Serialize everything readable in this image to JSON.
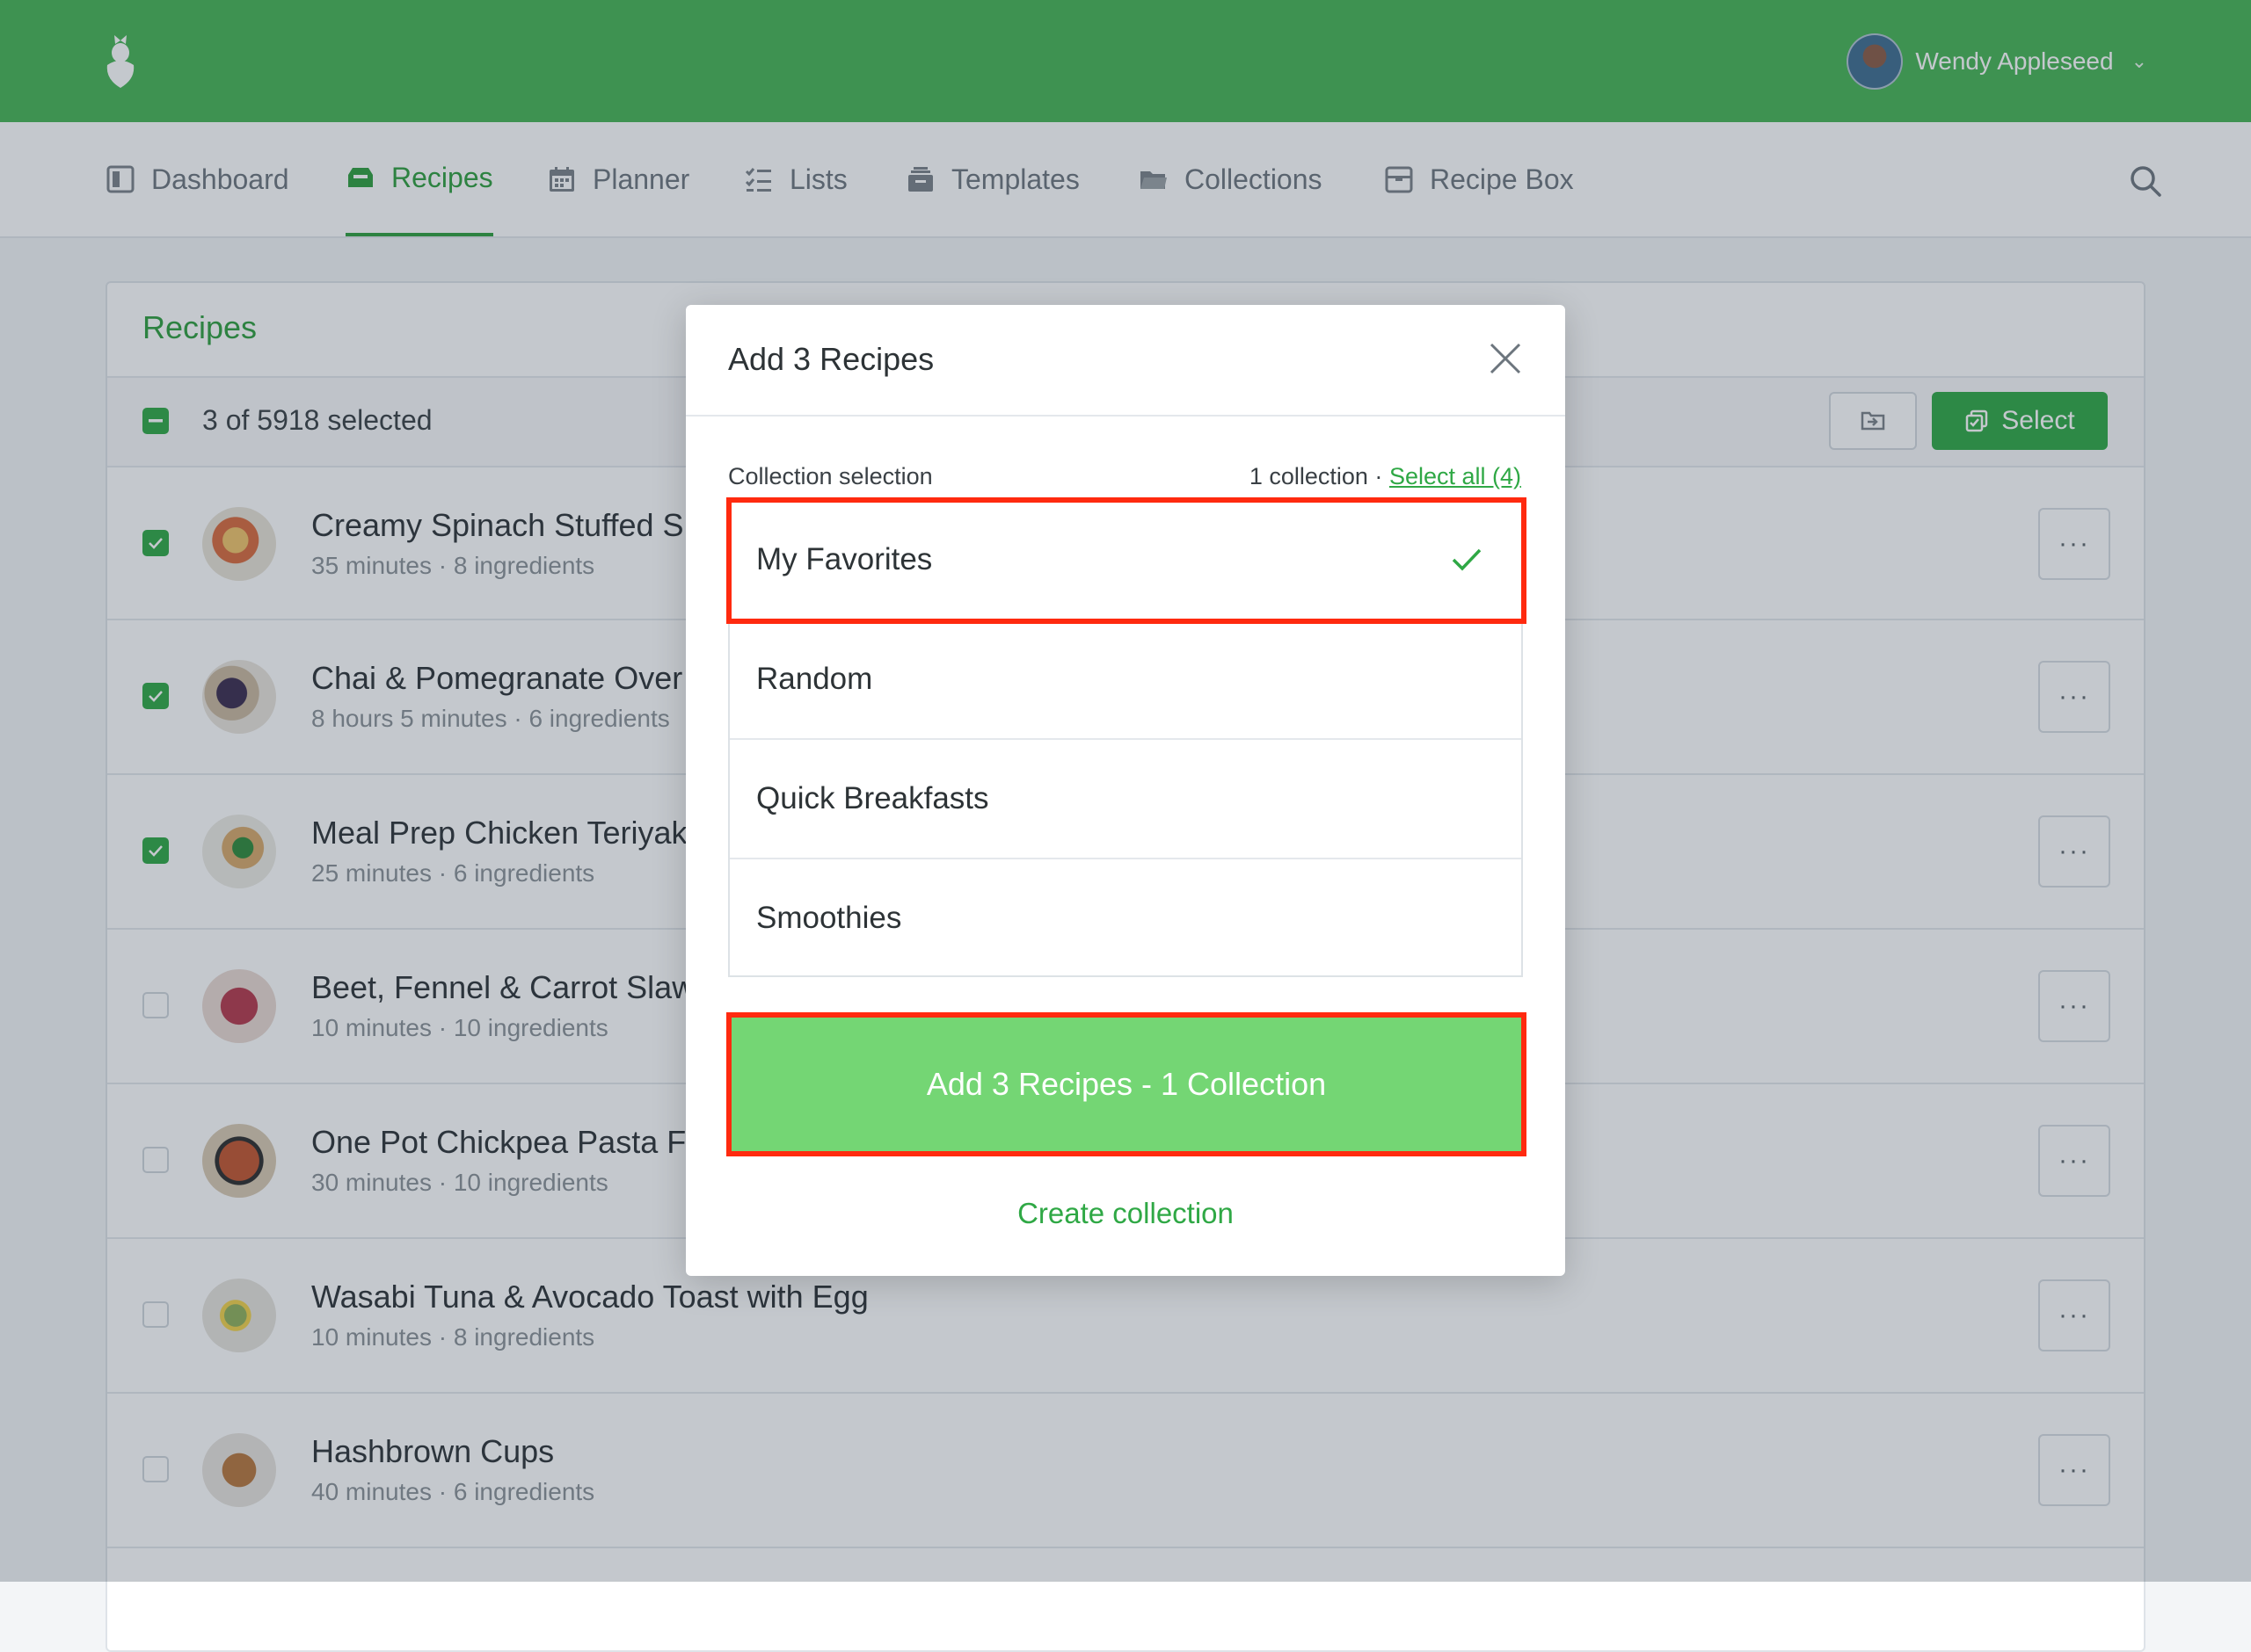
{
  "header": {
    "user_name": "Wendy Appleseed",
    "user_menu_chevron": "⌄"
  },
  "nav": {
    "items": [
      {
        "label": "Dashboard",
        "icon": "dashboard-icon"
      },
      {
        "label": "Recipes",
        "icon": "recipe-tray-icon",
        "active": true
      },
      {
        "label": "Planner",
        "icon": "calendar-icon"
      },
      {
        "label": "Lists",
        "icon": "checklist-icon"
      },
      {
        "label": "Templates",
        "icon": "template-box-icon"
      },
      {
        "label": "Collections",
        "icon": "folder-icon"
      },
      {
        "label": "Recipe Box",
        "icon": "box-icon"
      }
    ],
    "search_icon": "search-icon"
  },
  "panel": {
    "title": "Recipes",
    "selection_text": "3 of 5918 selected",
    "select_button": "Select",
    "recipes": [
      {
        "title": "Creamy Spinach Stuffed S",
        "meta": "35 minutes · 8 ingredients",
        "checked": true
      },
      {
        "title": "Chai & Pomegranate Over",
        "meta": "8 hours 5 minutes · 6 ingredients",
        "checked": true
      },
      {
        "title": "Meal Prep Chicken Teriyak",
        "meta": "25 minutes · 6 ingredients",
        "checked": true
      },
      {
        "title": "Beet, Fennel & Carrot Slaw",
        "meta": "10 minutes · 10 ingredients",
        "checked": false
      },
      {
        "title": "One Pot Chickpea Pasta Fa",
        "meta": "30 minutes · 10 ingredients",
        "checked": false
      },
      {
        "title": "Wasabi Tuna & Avocado Toast with Egg",
        "meta": "10 minutes · 8 ingredients",
        "checked": false
      },
      {
        "title": "Hashbrown Cups",
        "meta": "40 minutes · 6 ingredients",
        "checked": false
      }
    ],
    "more_label": "···"
  },
  "modal": {
    "title": "Add 3 Recipes",
    "section_label": "Collection selection",
    "count_text": "1 collection ·",
    "select_all": "Select all (4)",
    "collections": [
      {
        "name": "My Favorites",
        "selected": true
      },
      {
        "name": "Random",
        "selected": false
      },
      {
        "name": "Quick Breakfasts",
        "selected": false
      },
      {
        "name": "Smoothies",
        "selected": false
      }
    ],
    "submit_label": "Add 3 Recipes - 1 Collection",
    "create_label": "Create collection"
  },
  "colors": {
    "brand_green": "#46b454",
    "accent_green": "#2fa845",
    "highlight_red": "#ff2a0f",
    "submit_green": "#74d674"
  }
}
